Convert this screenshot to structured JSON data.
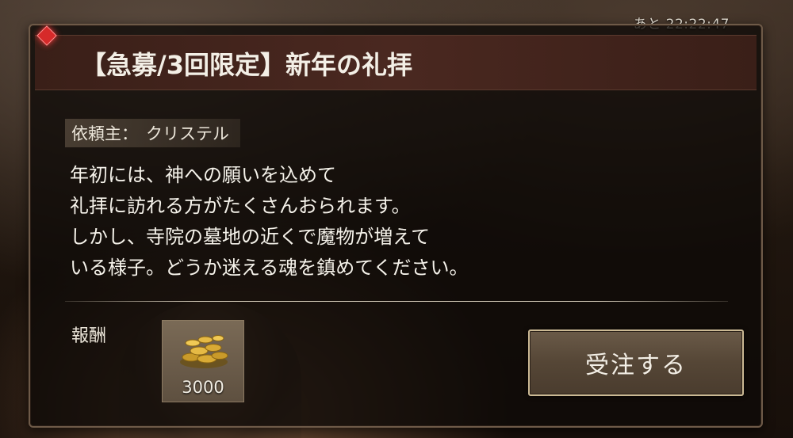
{
  "timer": {
    "text": "あと 22:22:47"
  },
  "quest": {
    "title": "【急募/3回限定】新年の礼拝",
    "client_label": "依頼主：",
    "client_name": "クリステル",
    "description_lines": [
      "年初には、神への願いを込めて",
      "礼拝に訪れる方がたくさんおられます。",
      "しかし、寺院の墓地の近くで魔物が増えて",
      "いる様子。どうか迷える魂を鎮めてください。"
    ]
  },
  "reward": {
    "label": "報酬",
    "item_icon": "gold-coins-icon",
    "amount": "3000"
  },
  "actions": {
    "accept_label": "受注する"
  },
  "colors": {
    "title_bar": "#4a2820",
    "gem": "#d62a2a",
    "button_border": "#cbb994"
  }
}
